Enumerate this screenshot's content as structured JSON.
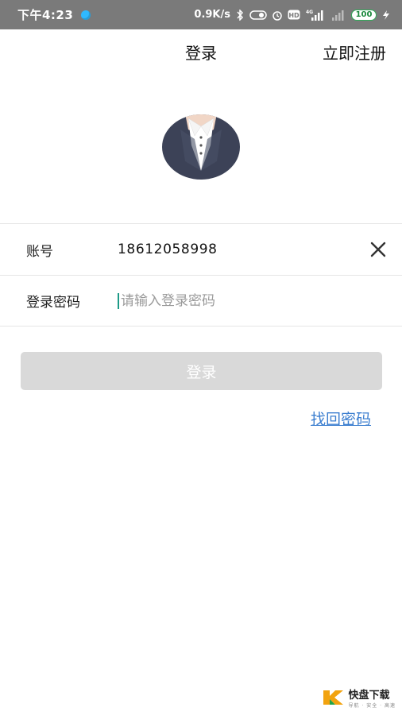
{
  "statusbar": {
    "time": "下午4:23",
    "net_speed": "0.9K/s",
    "battery": "100",
    "network": "4G",
    "hd": "HD"
  },
  "header": {
    "title": "登录",
    "register": "立即注册"
  },
  "form": {
    "account_label": "账号",
    "account_value": "18612058998",
    "password_label": "登录密码",
    "password_placeholder": "请输入登录密码"
  },
  "actions": {
    "login": "登录",
    "forgot": "找回密码"
  },
  "watermark": {
    "brand": "快盘下载",
    "tagline": "导航 · 安全 · 高速"
  },
  "colors": {
    "statusbar": "#7a7a7a",
    "login_disabled": "#d9d9d9",
    "link": "#3d7fd0",
    "cursor": "#1d9a87"
  }
}
